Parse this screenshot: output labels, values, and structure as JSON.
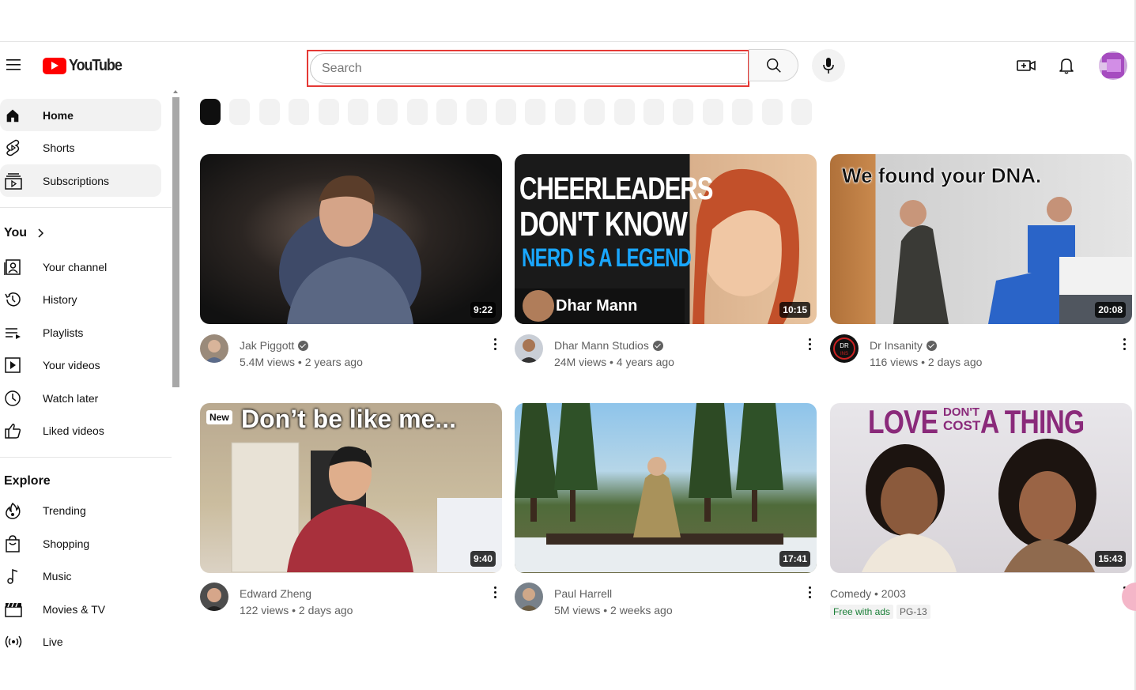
{
  "app": {
    "logo_text": "YouTube"
  },
  "search": {
    "placeholder": "Search",
    "value": ""
  },
  "sidebar": {
    "main": [
      {
        "label": "Home",
        "icon": "home-icon",
        "active": true
      },
      {
        "label": "Shorts",
        "icon": "shorts-icon"
      },
      {
        "label": "Subscriptions",
        "icon": "subscriptions-icon"
      }
    ],
    "you_title": "You",
    "you": [
      {
        "label": "Your channel",
        "icon": "your-channel-icon"
      },
      {
        "label": "History",
        "icon": "history-icon"
      },
      {
        "label": "Playlists",
        "icon": "playlists-icon"
      },
      {
        "label": "Your videos",
        "icon": "your-videos-icon"
      },
      {
        "label": "Watch later",
        "icon": "watch-later-icon"
      },
      {
        "label": "Liked videos",
        "icon": "liked-videos-icon"
      }
    ],
    "explore_title": "Explore",
    "explore": [
      {
        "label": "Trending",
        "icon": "trending-icon"
      },
      {
        "label": "Shopping",
        "icon": "shopping-icon"
      },
      {
        "label": "Music",
        "icon": "music-icon"
      },
      {
        "label": "Movies & TV",
        "icon": "movies-tv-icon"
      },
      {
        "label": "Live",
        "icon": "live-icon"
      }
    ]
  },
  "chips": {
    "count": 21,
    "selected_index": 0
  },
  "videos": [
    {
      "channel": "Jak Piggott",
      "verified": true,
      "stats": "5.4M views • 2 years ago",
      "duration": "9:22"
    },
    {
      "channel": "Dhar Mann Studios",
      "verified": true,
      "stats": "24M views • 4 years ago",
      "duration": "10:15",
      "thumb_text": [
        "CHEERLEADERS",
        "DON'T KNOW",
        "NERD IS A LEGEND",
        "Dhar Mann"
      ]
    },
    {
      "channel": "Dr Insanity",
      "verified": true,
      "stats": "116 views • 2 days ago",
      "duration": "20:08",
      "thumb_text": [
        "We found your DNA."
      ]
    },
    {
      "channel": "Edward Zheng",
      "verified": false,
      "stats": "122 views • 2 days ago",
      "duration": "9:40",
      "thumb_text": [
        "New",
        "Don’t be like me..."
      ]
    },
    {
      "channel": "Paul Harrell",
      "verified": false,
      "stats": "5M views • 2 weeks ago",
      "duration": "17:41"
    },
    {
      "channel": "Comedy • 2003",
      "verified": false,
      "badges": [
        "Free with ads",
        "PG-13"
      ],
      "duration": "15:43",
      "thumb_text": [
        "LOVE",
        "DON'T",
        "COST",
        "A THING"
      ]
    }
  ],
  "colors": {
    "brand": "#ff0000",
    "search_highlight": "#e53935",
    "active_bg": "#f2f2f2"
  }
}
